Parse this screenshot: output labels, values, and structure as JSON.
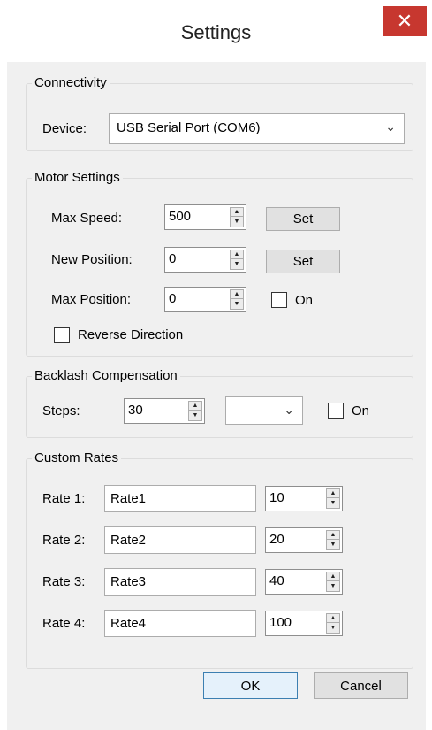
{
  "window": {
    "title": "Settings"
  },
  "connectivity": {
    "group_label": "Connectivity",
    "device_label": "Device:",
    "device_value": "USB Serial Port (COM6)"
  },
  "motor": {
    "group_label": "Motor Settings",
    "max_speed_label": "Max Speed:",
    "max_speed_value": "500",
    "new_position_label": "New Position:",
    "new_position_value": "0",
    "max_position_label": "Max Position:",
    "max_position_value": "0",
    "set_label": "Set",
    "on_label": "On",
    "reverse_label": "Reverse Direction"
  },
  "backlash": {
    "group_label": "Backlash Compensation",
    "steps_label": "Steps:",
    "steps_value": "30",
    "mode_value": "",
    "on_label": "On"
  },
  "custom_rates": {
    "group_label": "Custom Rates",
    "rows": [
      {
        "label": "Rate 1:",
        "name": "Rate1",
        "value": "10"
      },
      {
        "label": "Rate 2:",
        "name": "Rate2",
        "value": "20"
      },
      {
        "label": "Rate 3:",
        "name": "Rate3",
        "value": "40"
      },
      {
        "label": "Rate 4:",
        "name": "Rate4",
        "value": "100"
      }
    ]
  },
  "buttons": {
    "ok": "OK",
    "cancel": "Cancel"
  },
  "colors": {
    "close_button": "#c7372f",
    "dialog_bg": "#f0f0f0",
    "default_button_border": "#3c7fb1"
  }
}
